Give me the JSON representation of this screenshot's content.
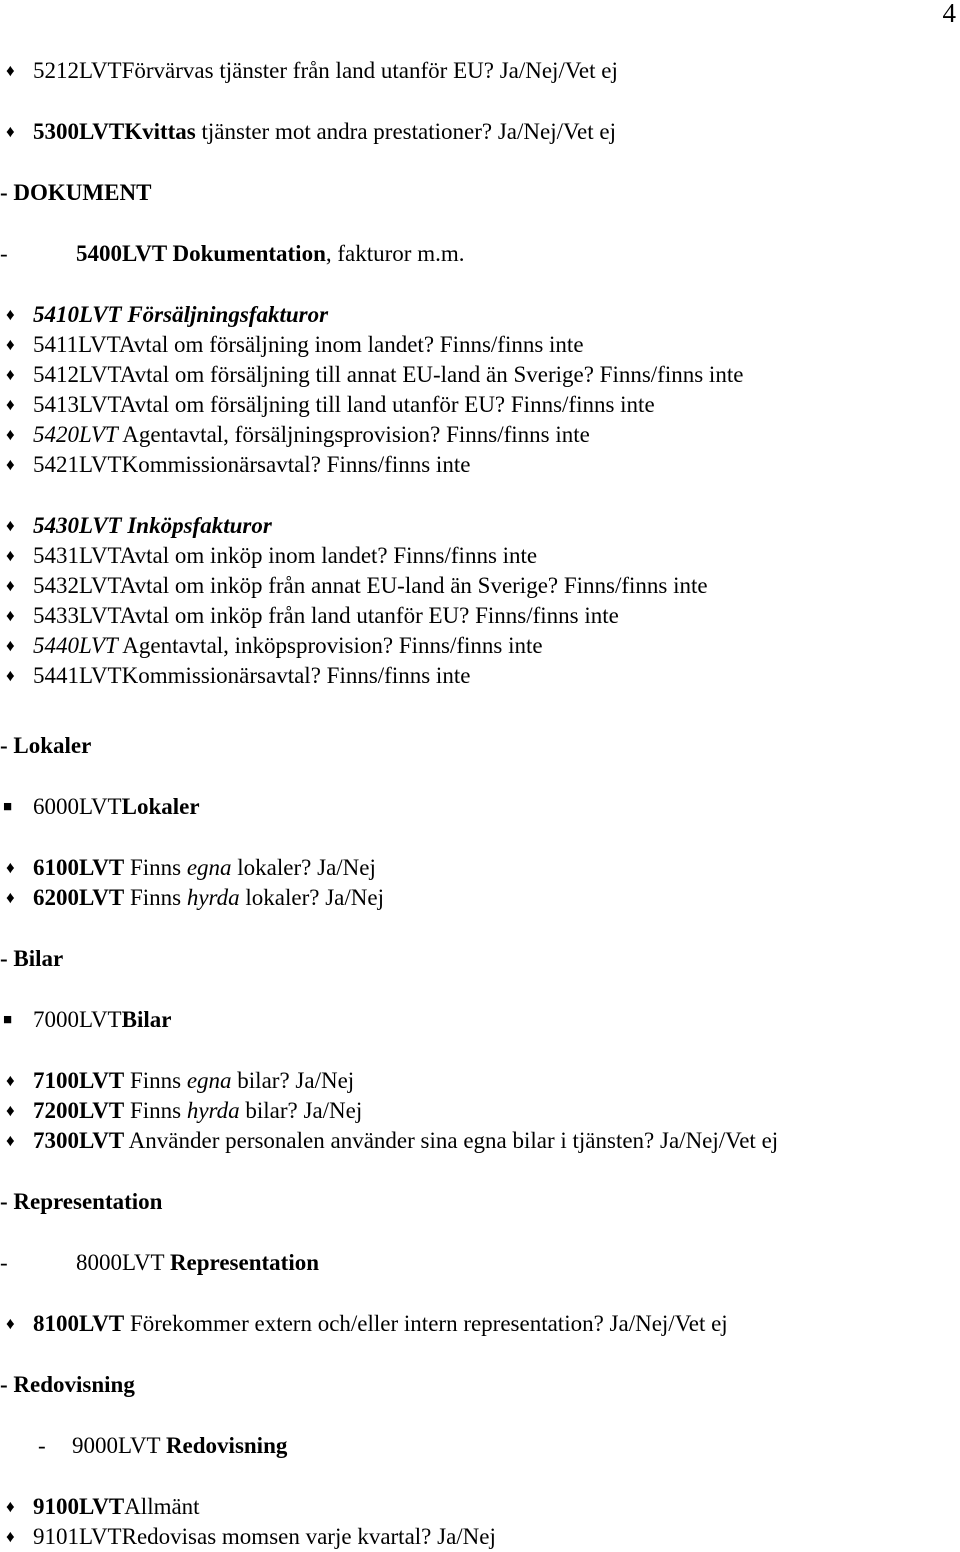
{
  "document": {
    "page_number": "4",
    "language": "sv",
    "blocks": [
      {
        "type": "bullet-diamond",
        "name": "item-5212lvt",
        "marker": "♦",
        "parts": [
          {
            "text": "5212LVT",
            "style": "n"
          },
          {
            "text": "Förvärvas tjänster från land utanför EU? Ja/Nej/Vet ej",
            "style": "n"
          }
        ]
      },
      {
        "type": "gap",
        "name": "gap-1",
        "size": "gap-md"
      },
      {
        "type": "bullet-diamond",
        "name": "item-5300lvt",
        "marker": "♦",
        "parts": [
          {
            "text": "5300LVT",
            "style": "b"
          },
          {
            "text": "Kvittas",
            "style": "b"
          },
          {
            "text": " tjänster mot andra prestationer? Ja/Nej/Vet ej",
            "style": "n"
          }
        ]
      },
      {
        "type": "gap",
        "name": "gap-2",
        "size": "gap-md"
      },
      {
        "type": "section-head",
        "name": "section-dokument",
        "parts": [
          {
            "text": "- DOKUMENT",
            "style": "b"
          }
        ]
      },
      {
        "type": "gap",
        "name": "gap-3",
        "size": "gap-md"
      },
      {
        "type": "bullet-dash",
        "name": "item-5400lvt",
        "marker": "-",
        "parts": [
          {
            "text": "5400LVT Dokumentation",
            "style": "b"
          },
          {
            "text": ", fakturor m.m.",
            "style": "n"
          }
        ]
      },
      {
        "type": "gap",
        "name": "gap-4",
        "size": "gap-md"
      },
      {
        "type": "bullet-diamond",
        "name": "item-5410lvt",
        "marker": "♦",
        "parts": [
          {
            "text": "5410LVT Försäljningsfakturor",
            "style": "bi"
          }
        ]
      },
      {
        "type": "bullet-diamond",
        "name": "item-5411lvt",
        "marker": "♦",
        "parts": [
          {
            "text": "5411LVT",
            "style": "n"
          },
          {
            "text": "Avtal om försäljning inom landet? Finns/finns inte",
            "style": "n"
          }
        ]
      },
      {
        "type": "bullet-diamond",
        "name": "item-5412lvt",
        "marker": "♦",
        "parts": [
          {
            "text": "5412LVT",
            "style": "n"
          },
          {
            "text": "Avtal om försäljning till annat EU-land än Sverige? Finns/finns inte",
            "style": "n"
          }
        ]
      },
      {
        "type": "bullet-diamond",
        "name": "item-5413lvt",
        "marker": "♦",
        "parts": [
          {
            "text": "5413LVT",
            "style": "n"
          },
          {
            "text": "Avtal om försäljning till land utanför EU? Finns/finns inte",
            "style": "n"
          }
        ]
      },
      {
        "type": "bullet-diamond",
        "name": "item-5420lvt",
        "marker": "♦",
        "parts": [
          {
            "text": "5420LVT",
            "style": "i"
          },
          {
            "text": " Agentavtal, försäljningsprovision? Finns/finns inte",
            "style": "n"
          }
        ]
      },
      {
        "type": "bullet-diamond",
        "name": "item-5421lvt",
        "marker": "♦",
        "parts": [
          {
            "text": "5421LVT",
            "style": "n"
          },
          {
            "text": "Kommissionärsavtal? Finns/finns inte",
            "style": "n"
          }
        ]
      },
      {
        "type": "gap",
        "name": "gap-5",
        "size": "gap-md"
      },
      {
        "type": "bullet-diamond",
        "name": "item-5430lvt",
        "marker": "♦",
        "parts": [
          {
            "text": "5430LVT Inköpsfakturor",
            "style": "bi"
          }
        ]
      },
      {
        "type": "bullet-diamond",
        "name": "item-5431lvt",
        "marker": "♦",
        "parts": [
          {
            "text": "5431LVT",
            "style": "n"
          },
          {
            "text": "Avtal om inköp inom landet? Finns/finns inte",
            "style": "n"
          }
        ]
      },
      {
        "type": "bullet-diamond",
        "name": "item-5432lvt",
        "marker": "♦",
        "parts": [
          {
            "text": "5432LVT",
            "style": "n"
          },
          {
            "text": "Avtal om inköp från annat EU-land än Sverige? Finns/finns inte",
            "style": "n"
          }
        ]
      },
      {
        "type": "bullet-diamond",
        "name": "item-5433lvt",
        "marker": "♦",
        "parts": [
          {
            "text": "5433LVT",
            "style": "n"
          },
          {
            "text": "Avtal om inköp från land utanför EU? Finns/finns inte",
            "style": "n"
          }
        ]
      },
      {
        "type": "bullet-diamond",
        "name": "item-5440lvt",
        "marker": "♦",
        "parts": [
          {
            "text": "5440LVT",
            "style": "i"
          },
          {
            "text": " Agentavtal, inköpsprovision? Finns/finns inte",
            "style": "n"
          }
        ]
      },
      {
        "type": "bullet-diamond",
        "name": "item-5441lvt",
        "marker": "♦",
        "parts": [
          {
            "text": "5441LVT",
            "style": "n"
          },
          {
            "text": "Kommissionärsavtal? Finns/finns inte",
            "style": "n"
          }
        ]
      },
      {
        "type": "gap",
        "name": "gap-6",
        "size": "gap-xl"
      },
      {
        "type": "section-head",
        "name": "section-lokaler",
        "parts": [
          {
            "text": "- Lokaler",
            "style": "b"
          }
        ]
      },
      {
        "type": "gap",
        "name": "gap-7",
        "size": "gap-md"
      },
      {
        "type": "bullet-square",
        "name": "item-6000lvt",
        "marker": "■",
        "parts": [
          {
            "text": "6000LVT",
            "style": "n"
          },
          {
            "text": "Lokaler",
            "style": "b"
          }
        ]
      },
      {
        "type": "gap",
        "name": "gap-8",
        "size": "gap-md"
      },
      {
        "type": "bullet-diamond",
        "name": "item-6100lvt",
        "marker": "♦",
        "parts": [
          {
            "text": "6100LVT",
            "style": "b"
          },
          {
            "text": " Finns ",
            "style": "n"
          },
          {
            "text": "egna",
            "style": "i"
          },
          {
            "text": " lokaler? Ja/Nej",
            "style": "n"
          }
        ]
      },
      {
        "type": "bullet-diamond",
        "name": "item-6200lvt",
        "marker": "♦",
        "parts": [
          {
            "text": "6200LVT",
            "style": "b"
          },
          {
            "text": " Finns ",
            "style": "n"
          },
          {
            "text": "hyrda",
            "style": "i"
          },
          {
            "text": " lokaler? Ja/Nej",
            "style": "n"
          }
        ]
      },
      {
        "type": "gap",
        "name": "gap-9",
        "size": "gap-md"
      },
      {
        "type": "section-head",
        "name": "section-bilar",
        "parts": [
          {
            "text": "- Bilar",
            "style": "b"
          }
        ]
      },
      {
        "type": "gap",
        "name": "gap-10",
        "size": "gap-md"
      },
      {
        "type": "bullet-square",
        "name": "item-7000lvt",
        "marker": "■",
        "parts": [
          {
            "text": "7000LVT",
            "style": "n"
          },
          {
            "text": "Bilar",
            "style": "b"
          }
        ]
      },
      {
        "type": "gap",
        "name": "gap-11",
        "size": "gap-md"
      },
      {
        "type": "bullet-diamond",
        "name": "item-7100lvt",
        "marker": "♦",
        "parts": [
          {
            "text": "7100LVT",
            "style": "b"
          },
          {
            "text": " Finns ",
            "style": "n"
          },
          {
            "text": "egna",
            "style": "i"
          },
          {
            "text": " bilar? Ja/Nej",
            "style": "n"
          }
        ]
      },
      {
        "type": "bullet-diamond",
        "name": "item-7200lvt",
        "marker": "♦",
        "parts": [
          {
            "text": "7200LVT",
            "style": "b"
          },
          {
            "text": " Finns ",
            "style": "n"
          },
          {
            "text": "hyrda",
            "style": "i"
          },
          {
            "text": " bilar? Ja/Nej",
            "style": "n"
          }
        ]
      },
      {
        "type": "bullet-diamond",
        "name": "item-7300lvt",
        "marker": "♦",
        "parts": [
          {
            "text": "7300LVT",
            "style": "b"
          },
          {
            "text": " Använder personalen använder sina egna bilar i tjänsten? Ja/Nej/Vet ej",
            "style": "n"
          }
        ]
      },
      {
        "type": "gap",
        "name": "gap-12",
        "size": "gap-md"
      },
      {
        "type": "section-head",
        "name": "section-representation",
        "parts": [
          {
            "text": "- Representation",
            "style": "b"
          }
        ]
      },
      {
        "type": "gap",
        "name": "gap-13",
        "size": "gap-md"
      },
      {
        "type": "bullet-dash",
        "name": "item-8000lvt",
        "marker": "-",
        "parts": [
          {
            "text": "8000LVT ",
            "style": "n"
          },
          {
            "text": "Representation",
            "style": "b"
          }
        ]
      },
      {
        "type": "gap",
        "name": "gap-14",
        "size": "gap-md"
      },
      {
        "type": "bullet-diamond",
        "name": "item-8100lvt",
        "marker": "♦",
        "parts": [
          {
            "text": "8100LVT",
            "style": "b"
          },
          {
            "text": " Förekommer extern och/eller intern representation? Ja/Nej/Vet ej",
            "style": "n"
          }
        ]
      },
      {
        "type": "gap",
        "name": "gap-15",
        "size": "gap-md"
      },
      {
        "type": "section-head",
        "name": "section-redovisning",
        "parts": [
          {
            "text": "- Redovisning",
            "style": "b"
          }
        ]
      },
      {
        "type": "gap",
        "name": "gap-16",
        "size": "gap-md"
      },
      {
        "type": "bullet-dash-indent2",
        "name": "item-9000lvt",
        "marker": "-",
        "parts": [
          {
            "text": "9000LVT ",
            "style": "n"
          },
          {
            "text": "Redovisning",
            "style": "b"
          }
        ]
      },
      {
        "type": "gap",
        "name": "gap-17",
        "size": "gap-md"
      },
      {
        "type": "bullet-diamond",
        "name": "item-9100lvt",
        "marker": "♦",
        "parts": [
          {
            "text": "9100LVT",
            "style": "b"
          },
          {
            "text": "Allmänt",
            "style": "n"
          }
        ]
      },
      {
        "type": "bullet-diamond",
        "name": "item-9101lvt",
        "marker": "♦",
        "parts": [
          {
            "text": "9101LVT",
            "style": "n"
          },
          {
            "text": "Redovisas momsen varje kvartal? Ja/Nej",
            "style": "n"
          }
        ]
      }
    ]
  }
}
